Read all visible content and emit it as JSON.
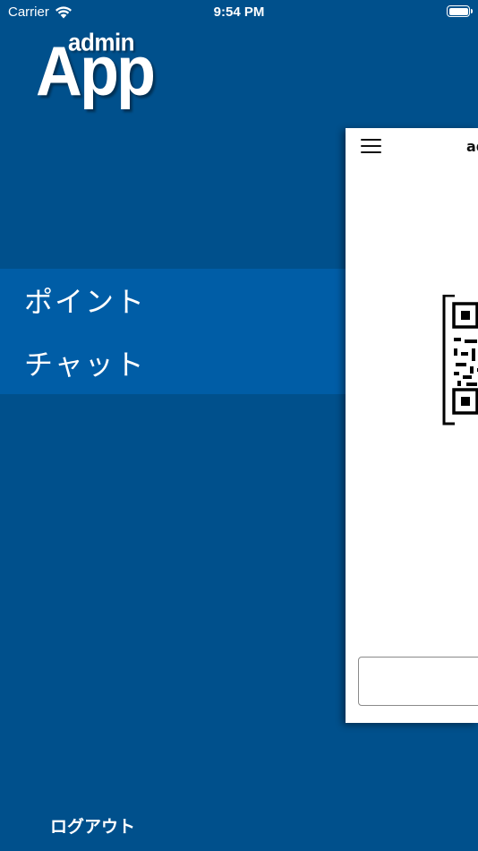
{
  "status_bar": {
    "carrier": "Carrier",
    "time": "9:54 PM",
    "wifi_icon": "wifi-icon",
    "battery_icon": "battery-icon"
  },
  "logo": {
    "small_text": "admin",
    "big_text": "App"
  },
  "menu": {
    "items": [
      {
        "label": "ポイント"
      },
      {
        "label": "チャット"
      }
    ]
  },
  "logout_label": "ログアウト",
  "panel": {
    "title": "ad",
    "menu_icon": "hamburger-icon",
    "qr_icon": "qr-code-icon",
    "input_value": ""
  },
  "colors": {
    "background": "#00508c",
    "menu_background": "#005da6",
    "panel_background": "#ffffff"
  }
}
